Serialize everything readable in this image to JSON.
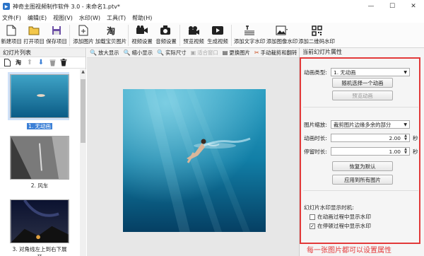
{
  "window": {
    "title": "神奇主图视频制作软件 3.0 - 未命名1.ptv*",
    "minimize": "—",
    "maximize": "☐",
    "close": "✕"
  },
  "menu": [
    "文件(F)",
    "编辑(E)",
    "视图(V)",
    "水印(W)",
    "工具(T)",
    "帮助(H)"
  ],
  "toolbar": [
    {
      "label": "新建项目",
      "icon": "new-project-icon"
    },
    {
      "label": "打开项目",
      "icon": "open-project-icon"
    },
    {
      "label": "保存项目",
      "icon": "save-project-icon"
    },
    {
      "label": "添加图片",
      "icon": "add-image-icon"
    },
    {
      "label": "加载宝贝图片",
      "icon": "taobao-icon"
    },
    {
      "label": "视频设置",
      "icon": "video-settings-icon"
    },
    {
      "label": "音频设置",
      "icon": "audio-settings-icon"
    },
    {
      "label": "预览视频",
      "icon": "preview-video-icon"
    },
    {
      "label": "生成视频",
      "icon": "generate-video-icon"
    },
    {
      "label": "添加文字水印",
      "icon": "text-watermark-icon"
    },
    {
      "label": "添加图像水印",
      "icon": "image-watermark-icon"
    },
    {
      "label": "添加二维码水印",
      "icon": "qrcode-icon"
    }
  ],
  "left_panel": {
    "title": "幻灯片列表",
    "slides": [
      {
        "label": "1. 无动画",
        "selected": true
      },
      {
        "label": "2. 风车",
        "selected": false
      },
      {
        "label": "3. 对角线左上到右下展开",
        "selected": false
      }
    ]
  },
  "view_tools": [
    {
      "label": "放大显示",
      "icon": "zoom-in-icon",
      "disabled": false
    },
    {
      "label": "缩小显示",
      "icon": "zoom-out-icon",
      "disabled": false
    },
    {
      "label": "实际尺寸",
      "icon": "actual-size-icon",
      "disabled": false
    },
    {
      "label": "适合窗口",
      "icon": "fit-window-icon",
      "disabled": true
    },
    {
      "label": "更换图片",
      "icon": "replace-image-icon",
      "disabled": false
    },
    {
      "label": "手动裁剪和翻转",
      "icon": "crop-icon",
      "disabled": false
    }
  ],
  "properties": {
    "title": "当前幻灯片属性",
    "animation_type_label": "动画类型:",
    "animation_type_value": "1. 无动画",
    "random_button": "随机选择一个动画",
    "preview_button": "预览动画",
    "scale_label": "图片缩放:",
    "scale_value": "裁剪图片边缘多余的部分",
    "anim_duration_label": "动画时长:",
    "anim_duration_value": "2.00",
    "stay_duration_label": "停留时长:",
    "stay_duration_value": "1.00",
    "seconds": "秒",
    "reset_button": "恢复为默认",
    "apply_all_button": "应用到所有图片",
    "watermark_title": "幻灯片水印显示时机:",
    "wm_option1": "在动画过程中显示水印",
    "wm_option1_checked": false,
    "wm_option2": "在停顿过程中显示水印",
    "wm_option2_checked": true
  },
  "caption": "每一张图片都可以设置属性",
  "colors": {
    "accent": "#e23a3a",
    "selected": "#3c80d6"
  }
}
